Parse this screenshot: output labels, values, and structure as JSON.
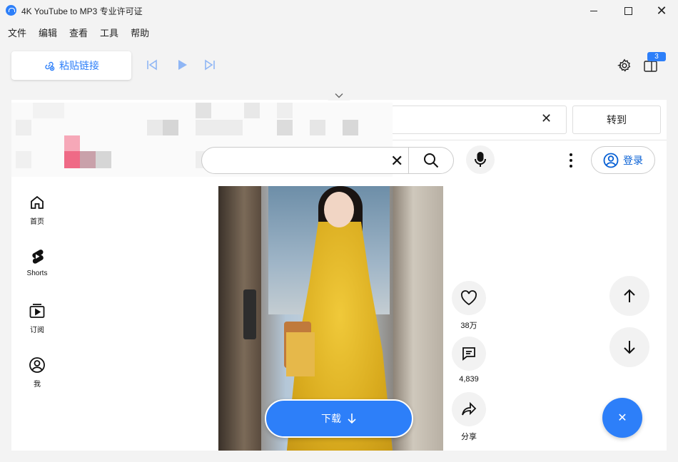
{
  "window": {
    "title": "4K YouTube to MP3 专业许可证"
  },
  "menu": [
    "文件",
    "编辑",
    "查看",
    "工具",
    "帮助"
  ],
  "toolbar": {
    "paste_label": "粘贴链接",
    "badge_count": "3"
  },
  "browser": {
    "goto_label": "转到",
    "url_value": ""
  },
  "youtube": {
    "login_label": "登录",
    "nav": [
      {
        "label": "首页",
        "icon": "home-icon"
      },
      {
        "label": "Shorts",
        "icon": "shorts-icon"
      },
      {
        "label": "订阅",
        "icon": "subscriptions-icon"
      },
      {
        "label": "我",
        "icon": "account-icon"
      }
    ],
    "actions": {
      "likes": "38万",
      "comments": "4,839",
      "share": "分享"
    },
    "download_label": "下载"
  },
  "colors": {
    "accent": "#2d7ff9",
    "youtube_blue": "#065fd4"
  }
}
